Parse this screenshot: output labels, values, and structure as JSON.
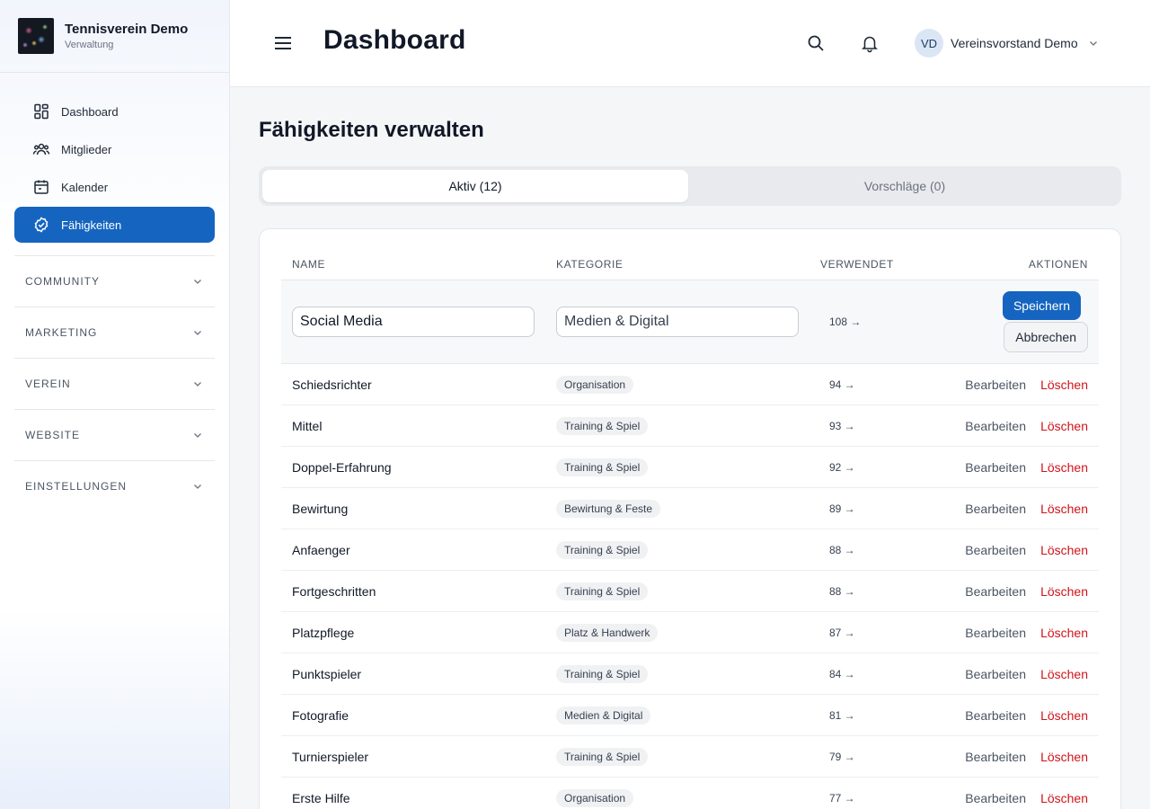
{
  "brand": {
    "title": "Tennisverein Demo",
    "subtitle": "Verwaltung"
  },
  "nav": [
    {
      "label": "Dashboard",
      "icon": "dashboard-icon"
    },
    {
      "label": "Mitglieder",
      "icon": "users-icon"
    },
    {
      "label": "Kalender",
      "icon": "calendar-icon"
    },
    {
      "label": "Fähigkeiten",
      "icon": "check-badge-icon",
      "active": true
    }
  ],
  "sections": [
    "COMMUNITY",
    "MARKETING",
    "VEREIN",
    "WEBSITE",
    "EINSTELLUNGEN"
  ],
  "header": {
    "title": "Dashboard",
    "user_initials": "VD",
    "user_name": "Vereinsvorstand Demo"
  },
  "page": {
    "title": "Fähigkeiten verwalten"
  },
  "tabs": [
    {
      "label": "Aktiv (12)",
      "active": true
    },
    {
      "label": "Vorschläge (0)"
    }
  ],
  "table": {
    "columns": {
      "name": "NAME",
      "category": "KATEGORIE",
      "used": "VERWENDET",
      "actions": "AKTIONEN"
    },
    "edit_row": {
      "name": "Social Media",
      "category": "Medien & Digital",
      "used": "108 →",
      "save": "Speichern",
      "cancel": "Abbrechen"
    },
    "rows": [
      {
        "name": "Schiedsrichter",
        "category": "Organisation",
        "used": "94 →"
      },
      {
        "name": "Mittel",
        "category": "Training & Spiel",
        "used": "93 →"
      },
      {
        "name": "Doppel-Erfahrung",
        "category": "Training & Spiel",
        "used": "92 →"
      },
      {
        "name": "Bewirtung",
        "category": "Bewirtung & Feste",
        "used": "89 →"
      },
      {
        "name": "Anfaenger",
        "category": "Training & Spiel",
        "used": "88 →"
      },
      {
        "name": "Fortgeschritten",
        "category": "Training & Spiel",
        "used": "88 →"
      },
      {
        "name": "Platzpflege",
        "category": "Platz & Handwerk",
        "used": "87 →"
      },
      {
        "name": "Punktspieler",
        "category": "Training & Spiel",
        "used": "84 →"
      },
      {
        "name": "Fotografie",
        "category": "Medien & Digital",
        "used": "81 →"
      },
      {
        "name": "Turnierspieler",
        "category": "Training & Spiel",
        "used": "79 →"
      },
      {
        "name": "Erste Hilfe",
        "category": "Organisation",
        "used": "77 →"
      }
    ],
    "edit_label": "Bearbeiten",
    "delete_label": "Löschen"
  },
  "colors": {
    "accent": "#1565c0",
    "danger": "#d0131a"
  }
}
